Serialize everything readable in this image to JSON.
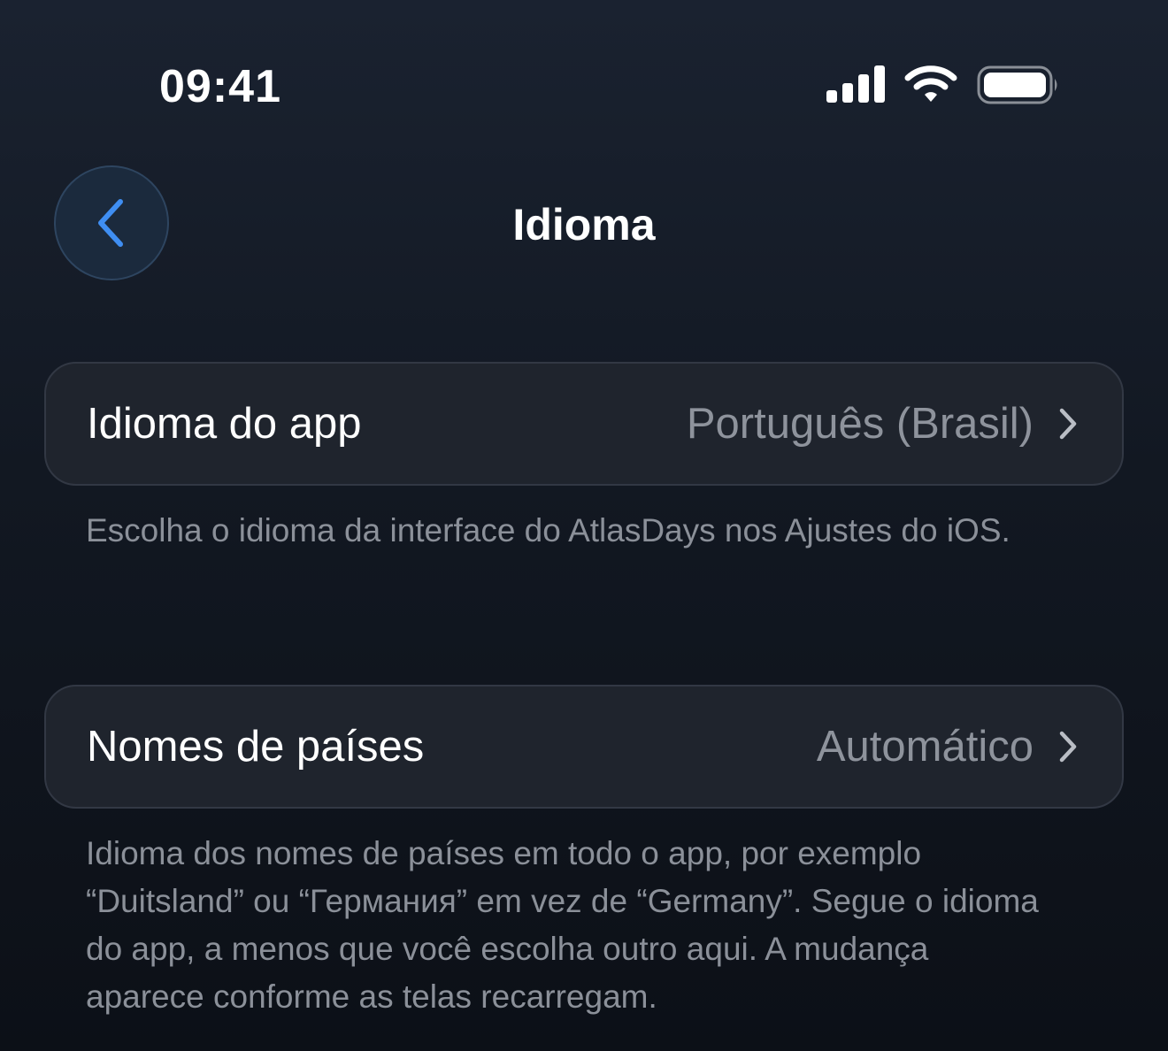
{
  "status_bar": {
    "time": "09:41",
    "icons": [
      "signal-icon",
      "wifi-icon",
      "battery-icon"
    ]
  },
  "nav": {
    "back_icon": "chevron-left-icon",
    "title": "Idioma"
  },
  "settings": {
    "app_language": {
      "label": "Idioma do app",
      "value": "Português (Brasil)",
      "footnote": "Escolha o idioma da interface do AtlasDays nos Ajustes do iOS."
    },
    "country_names": {
      "label": "Nomes de países",
      "value": "Automático",
      "footnote": "Idioma dos nomes de países em todo o app, por exemplo “Duitsland” ou “Германия” em vez de “Germany”. Segue o idioma do app, a menos que você escolha outro aqui. A mudança aparece conforme as telas recarregam."
    }
  },
  "colors": {
    "accent": "#3f8ef2",
    "card_background": "#1f242d",
    "secondary_text": "#8e939c"
  }
}
